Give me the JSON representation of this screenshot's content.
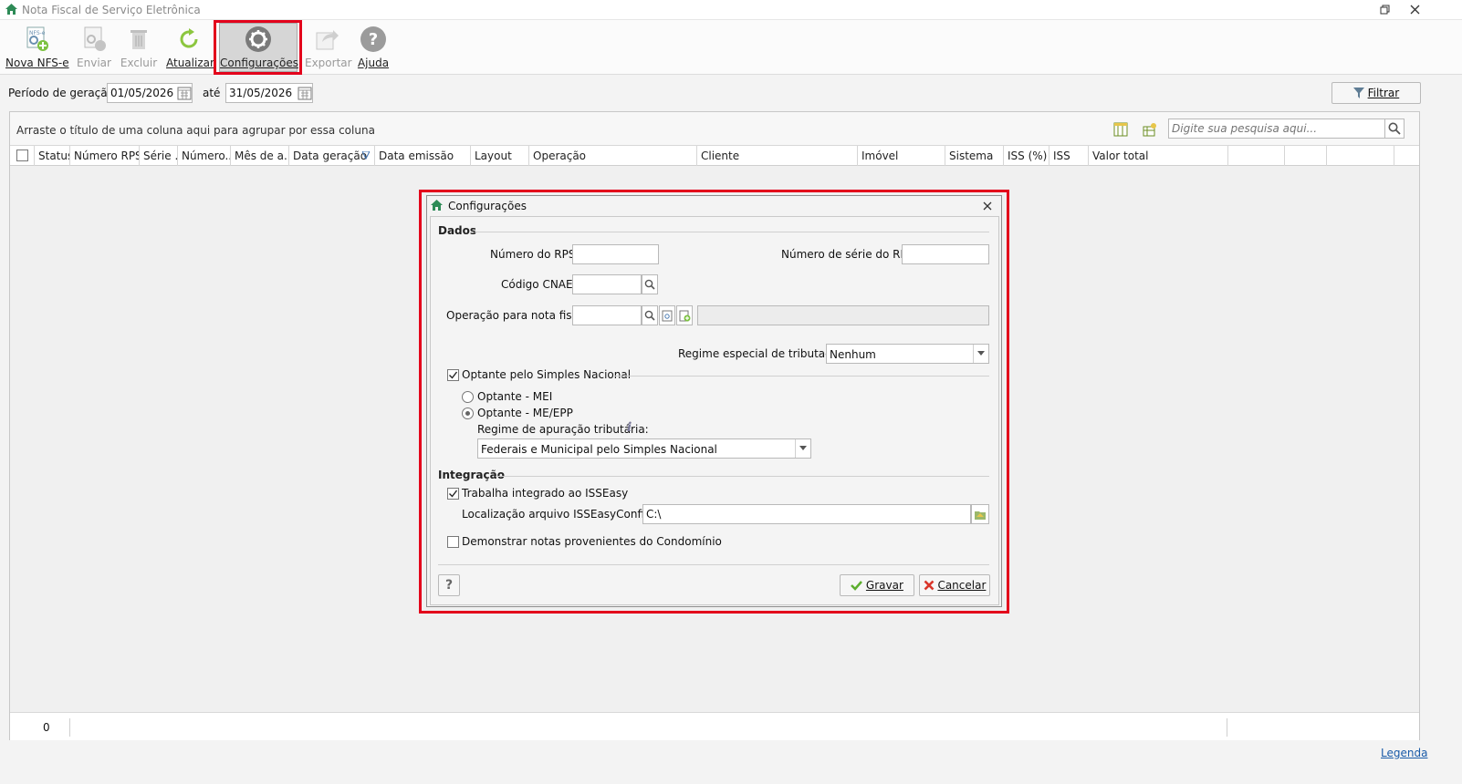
{
  "window": {
    "title": "Nota Fiscal de Serviço Eletrônica"
  },
  "toolbar": {
    "nova": "Nova NFS-e",
    "enviar": "Enviar",
    "excluir": "Excluir",
    "atualizar": "Atualizar",
    "configuracoes": "Configurações",
    "exportar": "Exportar",
    "ajuda": "Ajuda"
  },
  "filter": {
    "periodo_label": "Período de geração:",
    "from": "01/05/2026",
    "ate_label": "até",
    "to": "31/05/2026",
    "filtrar": "Filtrar"
  },
  "grid": {
    "group_hint": "Arraste o título de uma coluna aqui para agrupar por essa coluna",
    "search_placeholder": "Digite sua pesquisa aqui...",
    "columns": [
      "Status",
      "Número RPS",
      "Série ...",
      "Número...",
      "Mês de a...",
      "Data geração",
      "Data emissão",
      "Layout",
      "Operação",
      "Cliente",
      "Imóvel",
      "Sistema",
      "ISS (%)",
      "ISS",
      "Valor total"
    ],
    "count": "0"
  },
  "legenda": "Legenda",
  "dialog": {
    "title": "Configurações",
    "dados": "Dados",
    "numero_rps": "Número do RPS:",
    "numero_serie": "Número de série do RPS:",
    "cnae": "Código CNAE:",
    "operacao": "Operação para nota fiscal:",
    "regime_especial": "Regime especial de tributação:",
    "regime_especial_value": "Nenhum",
    "optante_simples": "Optante pelo Simples Nacional",
    "optante_mei": "Optante - MEI",
    "optante_meepp": "Optante - ME/EPP",
    "regime_apuracao": "Regime de apuração tributária:",
    "regime_apuracao_value": "Federais e Municipal pelo Simples Nacional",
    "integracao": "Integração",
    "trabalha_integrado": "Trabalha integrado ao ISSEasy",
    "localizacao": "Localização arquivo ISSEasyConfig.Ini:",
    "localizacao_value": "C:\\",
    "demonstrar": "Demonstrar notas provenientes do Condomínio",
    "gravar": "Gravar",
    "cancelar": "Cancelar",
    "help": "?"
  },
  "colors": {
    "highlight": "#e3001b",
    "accent_green": "#6cc04a",
    "gear_gray": "#7a7a7a"
  }
}
